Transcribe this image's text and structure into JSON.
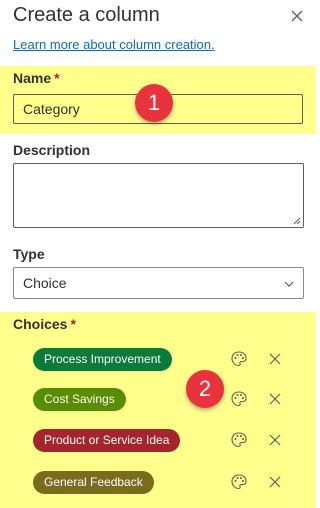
{
  "panel": {
    "title": "Create a column",
    "learn_link": "Learn more about column creation."
  },
  "name_field": {
    "label": "Name",
    "required_marker": "*",
    "value": "Category"
  },
  "description_field": {
    "label": "Description",
    "value": ""
  },
  "type_field": {
    "label": "Type",
    "value": "Choice"
  },
  "choices_field": {
    "label": "Choices",
    "required_marker": "*",
    "items": [
      {
        "label": "Process Improvement",
        "color": "#0b7a3b"
      },
      {
        "label": "Cost Savings",
        "color": "#5a8c00"
      },
      {
        "label": "Product or Service Idea",
        "color": "#a4262c"
      },
      {
        "label": "General Feedback",
        "color": "#7a6b1e"
      }
    ]
  },
  "annotations": [
    {
      "text": "1"
    },
    {
      "text": "2"
    }
  ],
  "colors": {
    "highlight": "#ffff8c",
    "link": "#0f6cbd",
    "badge": "#e8333e"
  },
  "icons": {
    "close": "close-icon",
    "palette": "palette-icon",
    "remove": "remove-icon",
    "dropdown": "chevron-down-icon"
  }
}
